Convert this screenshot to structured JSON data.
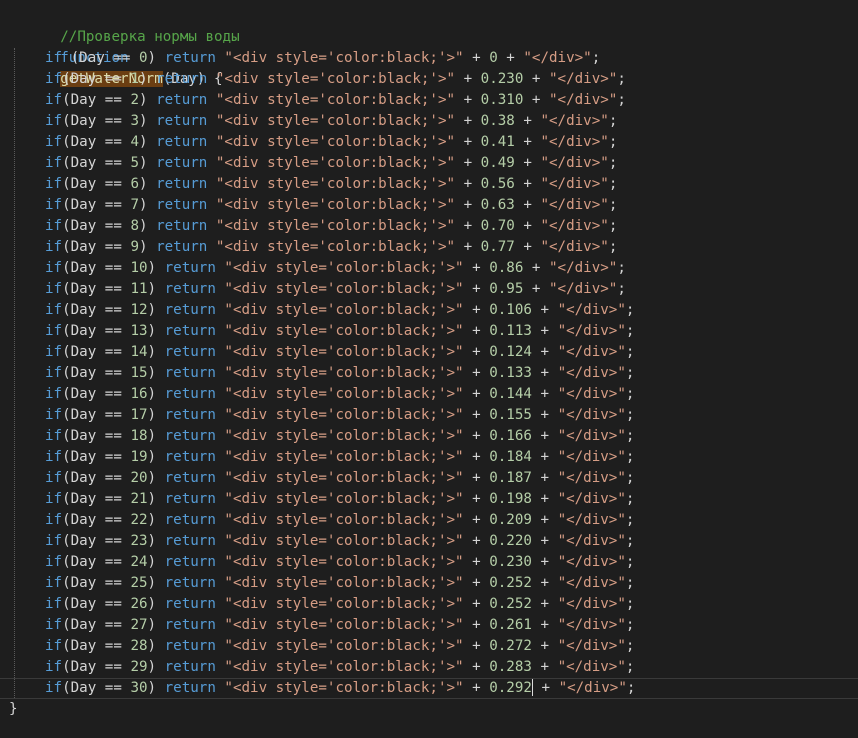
{
  "editor": {
    "comment": "//Проверка нормы воды",
    "function_keyword": "function",
    "function_name": "getWaterNorm",
    "signature_rest": "(Day) {",
    "closing_brace": "}",
    "lines": [
      {
        "prefix": "if (Day == ",
        "day": "0",
        "mid": ") ",
        "ret": "return",
        "str_open": "\"<div style='color:black;'>\"",
        "plus1": " + ",
        "value": "0",
        "plus2": " + ",
        "str_close": "\"</div>\"",
        "end": ";"
      },
      {
        "prefix": "if(Day == ",
        "day": "1",
        "mid": ") ",
        "ret": "return",
        "str_open": "\"<div style='color:black;'>\"",
        "plus1": " + ",
        "value": "0.230",
        "plus2": " + ",
        "str_close": "\"</div>\"",
        "end": ";"
      },
      {
        "prefix": "if(Day == ",
        "day": "2",
        "mid": ") ",
        "ret": "return",
        "str_open": "\"<div style='color:black;'>\"",
        "plus1": " + ",
        "value": "0.310",
        "plus2": " + ",
        "str_close": "\"</div>\"",
        "end": ";"
      },
      {
        "prefix": "if(Day == ",
        "day": "3",
        "mid": ") ",
        "ret": "return",
        "str_open": "\"<div style='color:black;'>\"",
        "plus1": " + ",
        "value": "0.38",
        "plus2": " + ",
        "str_close": "\"</div>\"",
        "end": ";"
      },
      {
        "prefix": "if(Day == ",
        "day": "4",
        "mid": ") ",
        "ret": "return",
        "str_open": "\"<div style='color:black;'>\"",
        "plus1": " + ",
        "value": "0.41",
        "plus2": " + ",
        "str_close": "\"</div>\"",
        "end": ";"
      },
      {
        "prefix": "if(Day == ",
        "day": "5",
        "mid": ") ",
        "ret": "return",
        "str_open": "\"<div style='color:black;'>\"",
        "plus1": " + ",
        "value": "0.49",
        "plus2": " + ",
        "str_close": "\"</div>\"",
        "end": ";"
      },
      {
        "prefix": "if(Day == ",
        "day": "6",
        "mid": ") ",
        "ret": "return",
        "str_open": "\"<div style='color:black;'>\"",
        "plus1": " + ",
        "value": "0.56",
        "plus2": " + ",
        "str_close": "\"</div>\"",
        "end": ";"
      },
      {
        "prefix": "if(Day == ",
        "day": "7",
        "mid": ") ",
        "ret": "return",
        "str_open": "\"<div style='color:black;'>\"",
        "plus1": " + ",
        "value": "0.63",
        "plus2": " + ",
        "str_close": "\"</div>\"",
        "end": ";"
      },
      {
        "prefix": "if(Day == ",
        "day": "8",
        "mid": ") ",
        "ret": "return",
        "str_open": "\"<div style='color:black;'>\"",
        "plus1": " + ",
        "value": "0.70",
        "plus2": " + ",
        "str_close": "\"</div>\"",
        "end": ";"
      },
      {
        "prefix": "if(Day == ",
        "day": "9",
        "mid": ") ",
        "ret": "return",
        "str_open": "\"<div style='color:black;'>\"",
        "plus1": " + ",
        "value": "0.77",
        "plus2": " + ",
        "str_close": "\"</div>\"",
        "end": ";"
      },
      {
        "prefix": "if(Day == ",
        "day": "10",
        "mid": ") ",
        "ret": "return",
        "str_open": "\"<div style='color:black;'>\"",
        "plus1": " + ",
        "value": "0.86",
        "plus2": " + ",
        "str_close": "\"</div>\"",
        "end": ";"
      },
      {
        "prefix": "if(Day == ",
        "day": "11",
        "mid": ") ",
        "ret": "return",
        "str_open": "\"<div style='color:black;'>\"",
        "plus1": " + ",
        "value": "0.95",
        "plus2": " + ",
        "str_close": "\"</div>\"",
        "end": ";"
      },
      {
        "prefix": "if(Day == ",
        "day": "12",
        "mid": ") ",
        "ret": "return",
        "str_open": "\"<div style='color:black;'>\"",
        "plus1": " + ",
        "value": "0.106",
        "plus2": " + ",
        "str_close": "\"</div>\"",
        "end": ";"
      },
      {
        "prefix": "if(Day == ",
        "day": "13",
        "mid": ") ",
        "ret": "return",
        "str_open": "\"<div style='color:black;'>\"",
        "plus1": " + ",
        "value": "0.113",
        "plus2": " + ",
        "str_close": "\"</div>\"",
        "end": ";"
      },
      {
        "prefix": "if(Day == ",
        "day": "14",
        "mid": ") ",
        "ret": "return",
        "str_open": "\"<div style='color:black;'>\"",
        "plus1": " + ",
        "value": "0.124",
        "plus2": " + ",
        "str_close": "\"</div>\"",
        "end": ";"
      },
      {
        "prefix": "if(Day == ",
        "day": "15",
        "mid": ") ",
        "ret": "return",
        "str_open": "\"<div style='color:black;'>\"",
        "plus1": " + ",
        "value": "0.133",
        "plus2": " + ",
        "str_close": "\"</div>\"",
        "end": ";"
      },
      {
        "prefix": "if(Day == ",
        "day": "16",
        "mid": ") ",
        "ret": "return",
        "str_open": "\"<div style='color:black;'>\"",
        "plus1": " + ",
        "value": "0.144",
        "plus2": " + ",
        "str_close": "\"</div>\"",
        "end": ";"
      },
      {
        "prefix": "if(Day == ",
        "day": "17",
        "mid": ") ",
        "ret": "return",
        "str_open": "\"<div style='color:black;'>\"",
        "plus1": " + ",
        "value": "0.155",
        "plus2": " + ",
        "str_close": "\"</div>\"",
        "end": ";"
      },
      {
        "prefix": "if(Day == ",
        "day": "18",
        "mid": ") ",
        "ret": "return",
        "str_open": "\"<div style='color:black;'>\"",
        "plus1": " + ",
        "value": "0.166",
        "plus2": " + ",
        "str_close": "\"</div>\"",
        "end": ";"
      },
      {
        "prefix": "if(Day == ",
        "day": "19",
        "mid": ") ",
        "ret": "return",
        "str_open": "\"<div style='color:black;'>\"",
        "plus1": " + ",
        "value": "0.184",
        "plus2": " + ",
        "str_close": "\"</div>\"",
        "end": ";"
      },
      {
        "prefix": "if(Day == ",
        "day": "20",
        "mid": ") ",
        "ret": "return",
        "str_open": "\"<div style='color:black;'>\"",
        "plus1": " + ",
        "value": "0.187",
        "plus2": " + ",
        "str_close": "\"</div>\"",
        "end": ";"
      },
      {
        "prefix": "if(Day == ",
        "day": "21",
        "mid": ") ",
        "ret": "return",
        "str_open": "\"<div style='color:black;'>\"",
        "plus1": " + ",
        "value": "0.198",
        "plus2": " + ",
        "str_close": "\"</div>\"",
        "end": ";"
      },
      {
        "prefix": "if(Day == ",
        "day": "22",
        "mid": ") ",
        "ret": "return",
        "str_open": "\"<div style='color:black;'>\"",
        "plus1": " + ",
        "value": "0.209",
        "plus2": " + ",
        "str_close": "\"</div>\"",
        "end": ";"
      },
      {
        "prefix": "if(Day == ",
        "day": "23",
        "mid": ") ",
        "ret": "return",
        "str_open": "\"<div style='color:black;'>\"",
        "plus1": " + ",
        "value": "0.220",
        "plus2": " + ",
        "str_close": "\"</div>\"",
        "end": ";"
      },
      {
        "prefix": "if(Day == ",
        "day": "24",
        "mid": ") ",
        "ret": "return",
        "str_open": "\"<div style='color:black;'>\"",
        "plus1": " + ",
        "value": "0.230",
        "plus2": " + ",
        "str_close": "\"</div>\"",
        "end": ";"
      },
      {
        "prefix": "if(Day == ",
        "day": "25",
        "mid": ") ",
        "ret": "return",
        "str_open": "\"<div style='color:black;'>\"",
        "plus1": " + ",
        "value": "0.252",
        "plus2": " + ",
        "str_close": "\"</div>\"",
        "end": ";"
      },
      {
        "prefix": "if(Day == ",
        "day": "26",
        "mid": ") ",
        "ret": "return",
        "str_open": "\"<div style='color:black;'>\"",
        "plus1": " + ",
        "value": "0.252",
        "plus2": " + ",
        "str_close": "\"</div>\"",
        "end": ";"
      },
      {
        "prefix": "if(Day == ",
        "day": "27",
        "mid": ") ",
        "ret": "return",
        "str_open": "\"<div style='color:black;'>\"",
        "plus1": " + ",
        "value": "0.261",
        "plus2": " + ",
        "str_close": "\"</div>\"",
        "end": ";"
      },
      {
        "prefix": "if(Day == ",
        "day": "28",
        "mid": ") ",
        "ret": "return",
        "str_open": "\"<div style='color:black;'>\"",
        "plus1": " + ",
        "value": "0.272",
        "plus2": " + ",
        "str_close": "\"</div>\"",
        "end": ";"
      },
      {
        "prefix": "if(Day == ",
        "day": "29",
        "mid": ") ",
        "ret": "return",
        "str_open": "\"<div style='color:black;'>\"",
        "plus1": " + ",
        "value": "0.283",
        "plus2": " + ",
        "str_close": "\"</div>\"",
        "end": ";"
      },
      {
        "prefix": "if(Day == ",
        "day": "30",
        "mid": ") ",
        "ret": "return",
        "str_open": "\"<div style='color:black;'>\"",
        "plus1": " + ",
        "value": "0.292",
        "plus2": " + ",
        "str_close": "\"</div>\"",
        "end": ";",
        "current": true
      }
    ]
  },
  "colors": {
    "background": "#1e1e1e",
    "comment": "#57a64a",
    "keyword": "#569cd6",
    "function_name": "#dcdcaa",
    "function_highlight": "#6b3e12",
    "string": "#d69d85",
    "number": "#b5cea8",
    "plain": "#d4d4d4"
  }
}
